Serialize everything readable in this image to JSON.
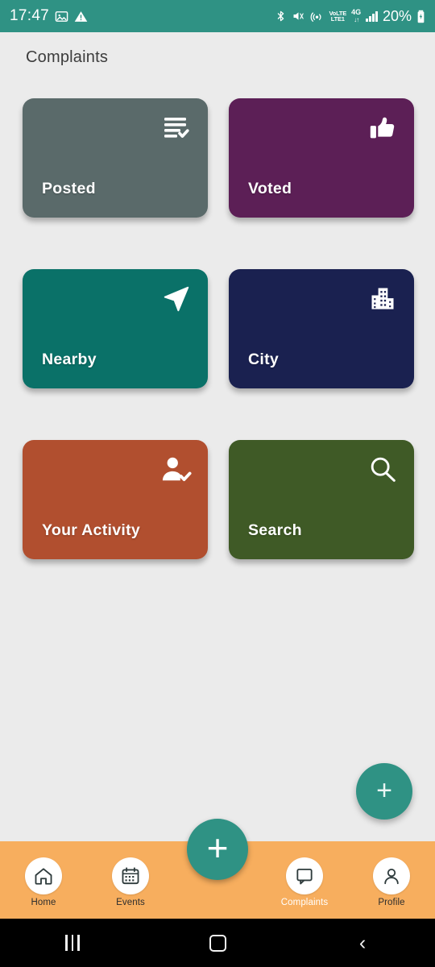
{
  "status_bar": {
    "time": "17:47",
    "background": "#2f9284",
    "left_icons": [
      "image-icon",
      "warning-icon"
    ],
    "right_icons": [
      "bluetooth-icon",
      "volume-mute-icon",
      "hotspot-icon"
    ],
    "volte_top": "VoLTE",
    "volte_label": "LTE1",
    "network_type": "4G",
    "data_arrows": "↓↑",
    "signal_icon": "signal-bars-icon",
    "battery_percent": "20%",
    "battery_icon": "battery-charging-icon"
  },
  "header": {
    "title": "Complaints"
  },
  "grid": {
    "cards": [
      {
        "id": "posted",
        "label": "Posted",
        "color": "#5a6a6a",
        "icon": "list-check-icon"
      },
      {
        "id": "voted",
        "label": "Voted",
        "color": "#5c1f56",
        "icon": "thumbs-up-icon"
      },
      {
        "id": "nearby",
        "label": "Nearby",
        "color": "#0a7168",
        "icon": "navigation-arrow-icon"
      },
      {
        "id": "city",
        "label": "City",
        "color": "#1a2150",
        "icon": "buildings-icon"
      },
      {
        "id": "your-activity",
        "label": "Your Activity",
        "color": "#b14f2f",
        "icon": "person-check-icon"
      },
      {
        "id": "search",
        "label": "Search",
        "color": "#3f5a26",
        "icon": "magnifier-icon"
      }
    ]
  },
  "fab_side": {
    "label": "+",
    "color": "#2f9284",
    "icon": "plus-icon"
  },
  "fab_center": {
    "label": "+",
    "color": "#2f9284",
    "icon": "plus-icon"
  },
  "bottom_nav": {
    "background": "#f7ae5e",
    "active": "complaints",
    "items": [
      {
        "id": "home",
        "label": "Home",
        "icon": "home-icon"
      },
      {
        "id": "events",
        "label": "Events",
        "icon": "calendar-icon"
      },
      {
        "id": "complaints",
        "label": "Complaints",
        "icon": "chat-bubble-icon"
      },
      {
        "id": "profile",
        "label": "Profile",
        "icon": "person-icon"
      }
    ]
  },
  "system_nav": {
    "recents": "recents-icon",
    "home": "home-square-icon",
    "back": "back-chevron-icon",
    "back_glyph": "‹"
  }
}
